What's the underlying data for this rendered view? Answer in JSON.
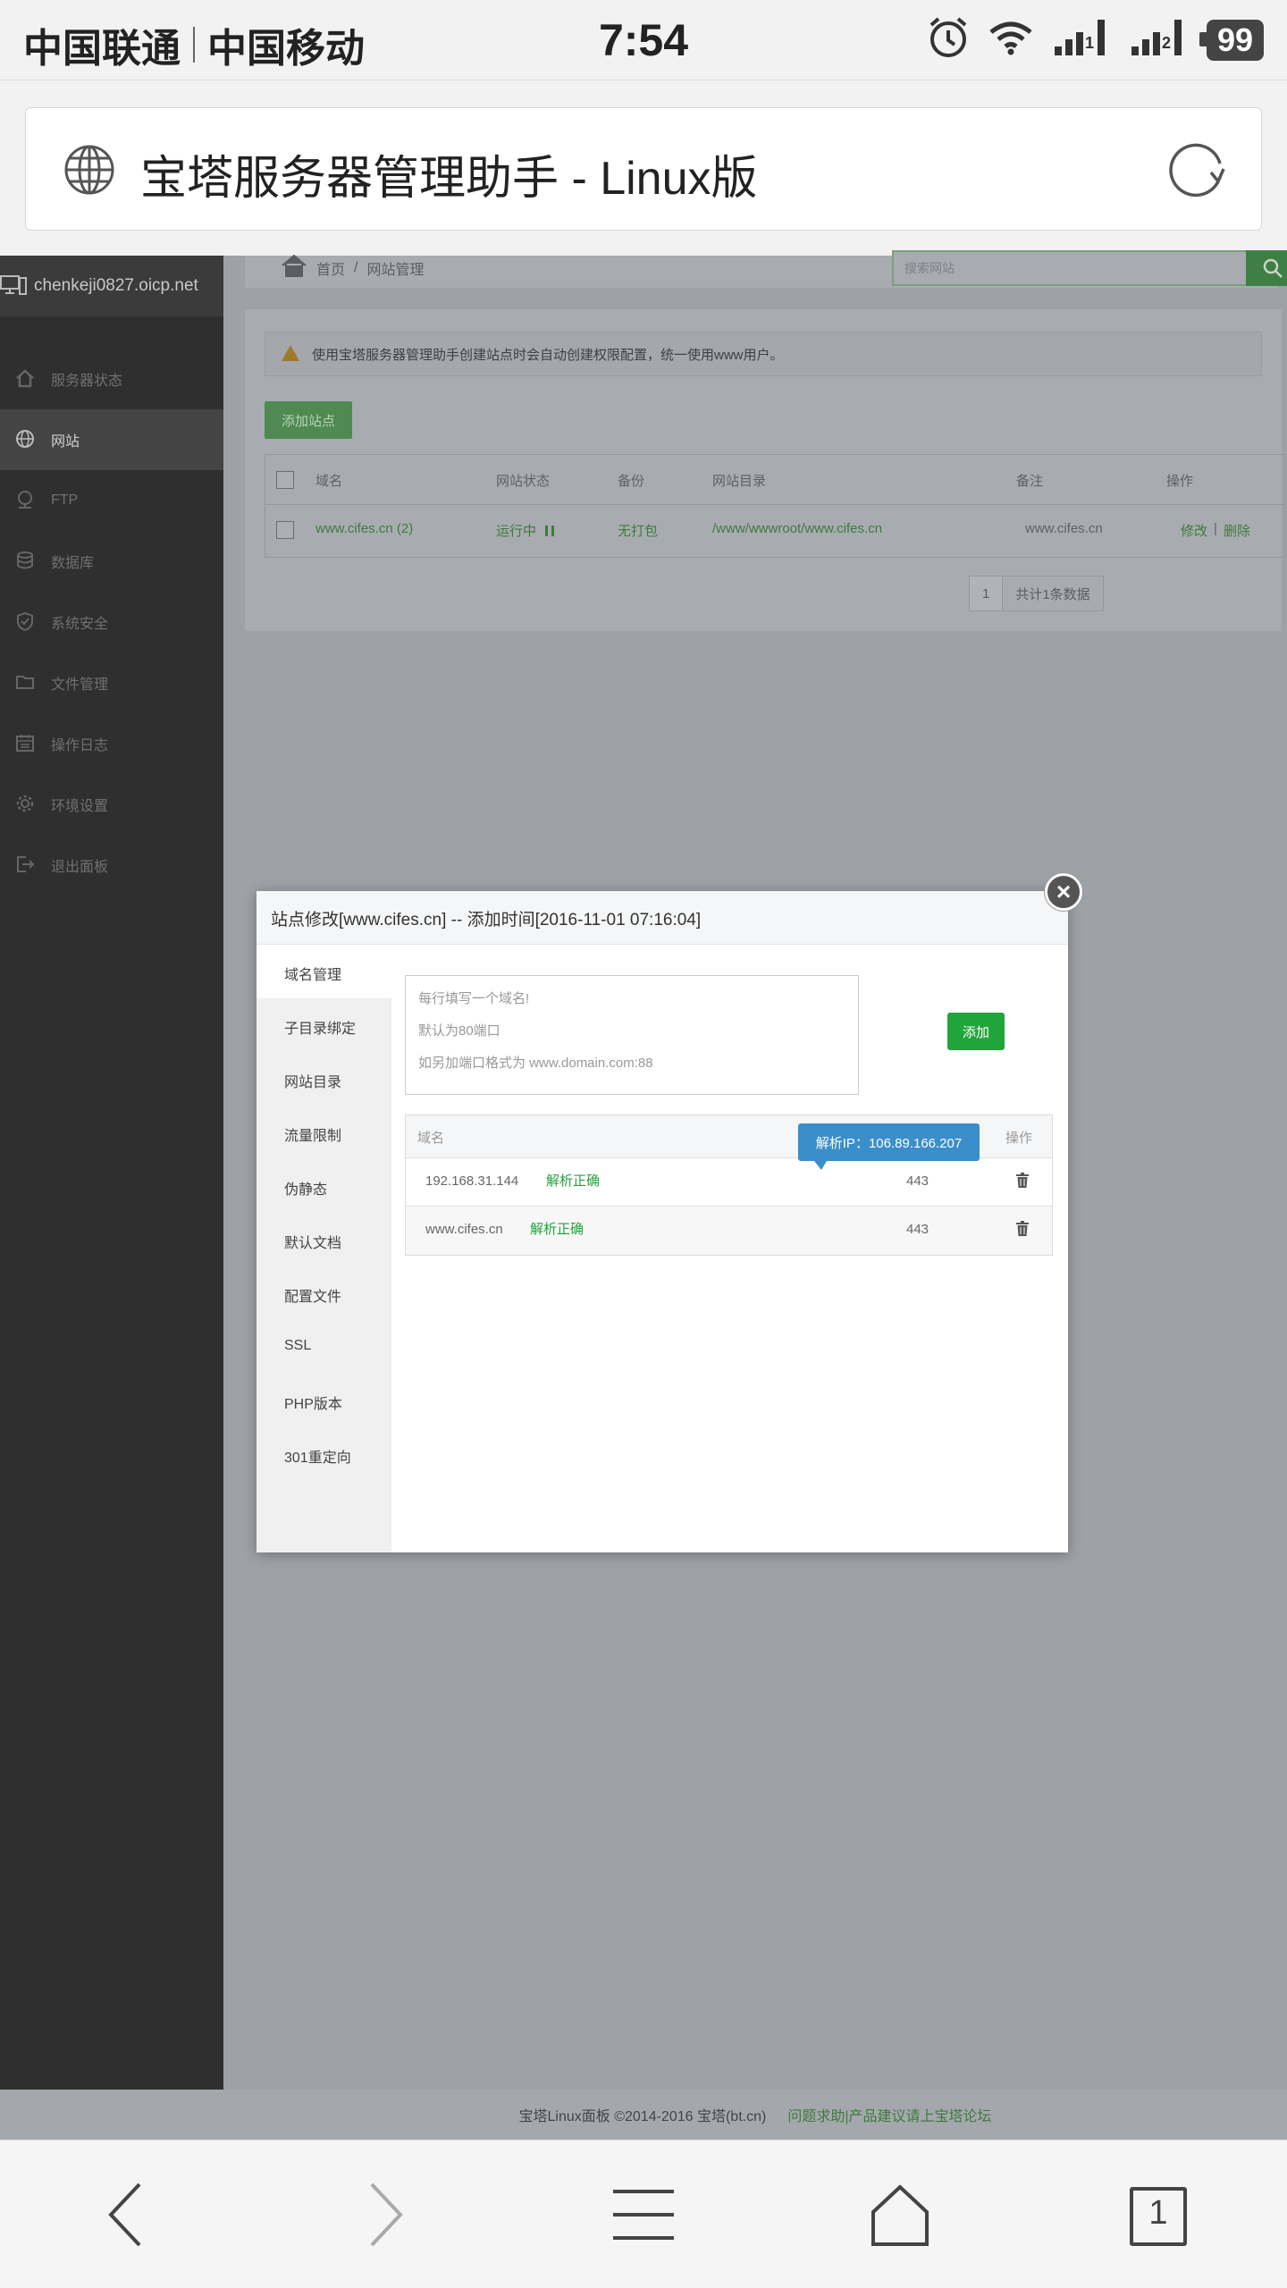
{
  "status_bar": {
    "carrier_1": "中国联通",
    "carrier_2": "中国移动",
    "time": "7:54",
    "battery": "99",
    "sim_1": "1",
    "sim_2": "2"
  },
  "browser": {
    "title": "宝塔服务器管理助手 - Linux版",
    "tab_count": "1"
  },
  "sidebar": {
    "host": "chenkeji0827.oicp.net",
    "items": [
      {
        "label": "服务器状态",
        "icon": "home-icon"
      },
      {
        "label": "网站",
        "icon": "globe-icon",
        "active": true
      },
      {
        "label": "FTP",
        "icon": "ftp-icon"
      },
      {
        "label": "数据库",
        "icon": "database-icon"
      },
      {
        "label": "系统安全",
        "icon": "shield-icon"
      },
      {
        "label": "文件管理",
        "icon": "folder-icon"
      },
      {
        "label": "操作日志",
        "icon": "calendar-icon"
      },
      {
        "label": "环境设置",
        "icon": "gear-icon"
      },
      {
        "label": "退出面板",
        "icon": "logout-icon"
      }
    ]
  },
  "breadcrumb": {
    "home": "首页",
    "sep": "/",
    "current": "网站管理"
  },
  "search": {
    "placeholder": "搜索网站"
  },
  "notice": "使用宝塔服务器管理助手创建站点时会自动创建权限配置，统一使用www用户。",
  "add_site_label": "添加站点",
  "sites_table": {
    "headers": [
      "域名",
      "网站状态",
      "备份",
      "网站目录",
      "备注",
      "操作"
    ],
    "rows": [
      {
        "domain": "www.cifes.cn (2)",
        "status": "运行中",
        "backup": "无打包",
        "dir": "/www/wwwroot/www.cifes.cn",
        "note": "www.cifes.cn",
        "edit": "修改",
        "op_sep": "|",
        "delete": "删除"
      }
    ]
  },
  "pager": {
    "page": "1",
    "total": "共计1条数据"
  },
  "modal": {
    "title": "站点修改[www.cifes.cn] -- 添加时间[2016-11-01 07:16:04]",
    "close": "×",
    "tabs": [
      "域名管理",
      "子目录绑定",
      "网站目录",
      "流量限制",
      "伪静态",
      "默认文档",
      "配置文件",
      "SSL",
      "PHP版本",
      "301重定向"
    ],
    "placeholder_lines": [
      "每行填写一个域名!",
      "默认为80端口",
      "如另加端口格式为 www.domain.com:88"
    ],
    "add_label": "添加",
    "table_headers": {
      "domain": "域名",
      "op": "操作"
    },
    "tooltip": "解析IP：106.89.166.207",
    "rows": [
      {
        "domain": "192.168.31.144",
        "check": "解析正确",
        "port": "443"
      },
      {
        "domain": "www.cifes.cn",
        "check": "解析正确",
        "port": "443"
      }
    ]
  },
  "footer": {
    "copyright": "宝塔Linux面板 ©2014-2016 宝塔(bt.cn)",
    "link": "问题求助|产品建议请上宝塔论坛"
  },
  "colors": {
    "accent_green": "#20a53a",
    "tooltip_blue": "#3a8ec9",
    "sidebar_bg": "#2f2f2f"
  }
}
